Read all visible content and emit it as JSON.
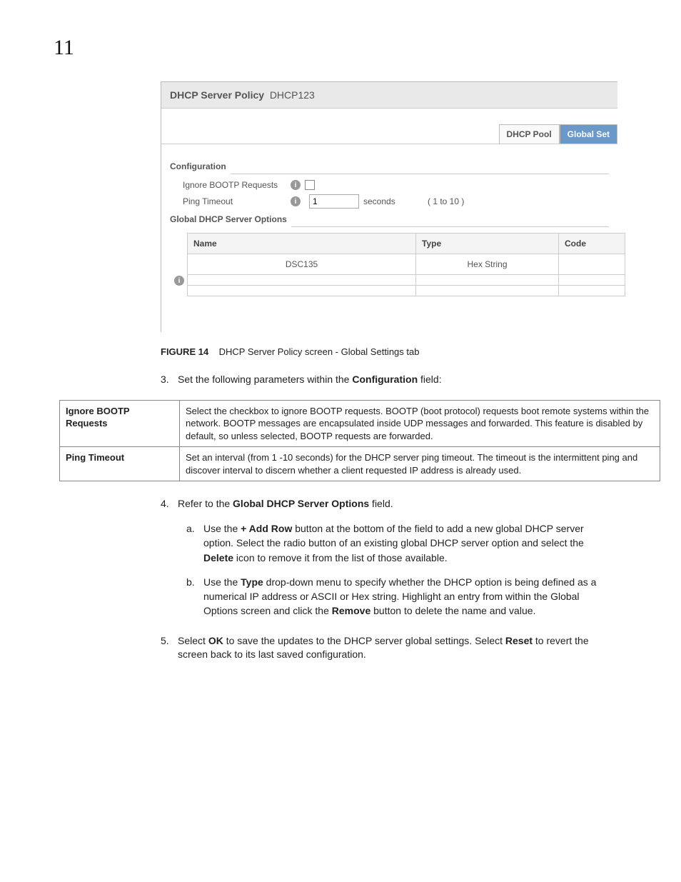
{
  "page_number": "11",
  "panel": {
    "title_prefix": "DHCP Server Policy",
    "title_name": "DHCP123",
    "tabs": {
      "pool": "DHCP Pool",
      "global": "Global Set"
    },
    "configuration": {
      "legend": "Configuration",
      "ignore_label": "Ignore BOOTP Requests",
      "ping_label": "Ping Timeout",
      "ping_value": "1",
      "ping_unit": "seconds",
      "ping_range": "( 1 to 10 )"
    },
    "global_options": {
      "legend": "Global DHCP Server Options",
      "headers": {
        "name": "Name",
        "type": "Type",
        "code": "Code"
      },
      "rows": [
        {
          "name": "DSC135",
          "type": "Hex String",
          "code": ""
        },
        {
          "name": "",
          "type": "",
          "code": ""
        },
        {
          "name": "",
          "type": "",
          "code": ""
        }
      ]
    }
  },
  "figure": {
    "label": "FIGURE 14",
    "caption": "DHCP Server Policy screen - Global Settings tab"
  },
  "step3": {
    "num": "3.",
    "pre": "Set the following parameters within the ",
    "bold": "Configuration",
    "post": " field:"
  },
  "desc": {
    "r1": {
      "label": "Ignore BOOTP Requests",
      "text": "Select the checkbox to ignore BOOTP requests. BOOTP (boot protocol) requests boot remote systems within the network. BOOTP messages are encapsulated inside UDP messages and forwarded. This feature is disabled by default, so unless selected, BOOTP requests are forwarded."
    },
    "r2": {
      "label": "Ping Timeout",
      "text": "Set an interval (from 1 -10 seconds) for the DHCP server ping timeout. The timeout is the intermittent ping and discover interval to discern whether a client requested IP address is already used."
    }
  },
  "step4": {
    "num": "4.",
    "pre": "Refer to the ",
    "bold": "Global DHCP Server Options",
    "post": " field."
  },
  "sub_a": {
    "let": "a.",
    "t1": "Use the ",
    "b1": "+ Add Row",
    "t2": " button at the bottom of the field to add a new global DHCP server option. Select the radio button of an existing global DHCP server option and select the ",
    "b2": "Delete",
    "t3": " icon to remove it from the list of those available."
  },
  "sub_b": {
    "let": "b.",
    "t1": "Use the ",
    "b1": "Type",
    "t2": " drop-down menu to specify whether the DHCP option is being defined as a numerical IP address or ASCII or Hex string. Highlight an entry from within the Global Options screen and click the ",
    "b2": "Remove",
    "t3": " button to delete the name and value."
  },
  "step5": {
    "num": "5.",
    "t1": "Select ",
    "b1": "OK",
    "t2": " to save the updates to the DHCP server global settings. Select ",
    "b2": "Reset",
    "t3": " to revert the screen back to its last saved configuration."
  }
}
